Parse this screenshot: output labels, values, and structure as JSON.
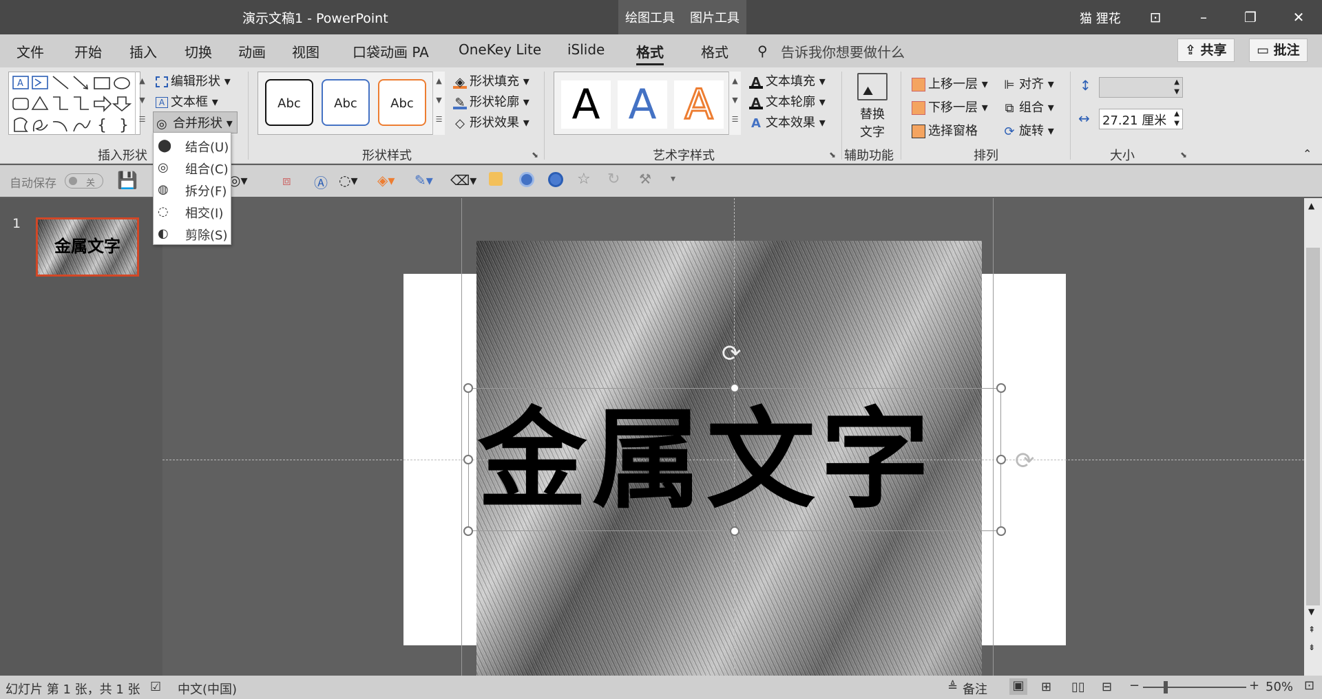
{
  "titlebar": {
    "doc_title": "演示文稿1  -  PowerPoint",
    "context_tabs": [
      "绘图工具",
      "图片工具"
    ],
    "user": "猫 狸花"
  },
  "tabs": {
    "items": [
      "文件",
      "开始",
      "插入",
      "切换",
      "动画",
      "视图",
      "口袋动画 PA",
      "OneKey Lite",
      "iSlide",
      "格式",
      "格式"
    ],
    "active": "格式",
    "search": "告诉我你想要做什么",
    "share": "共享",
    "comment": "批注"
  },
  "ribbon": {
    "insert_shapes": {
      "edit_shape": "编辑形状",
      "textbox": "文本框",
      "merge_shapes": "合并形状",
      "group_label": "插入形状"
    },
    "shape_styles": {
      "preview_text": "Abc",
      "fill": "形状填充",
      "outline": "形状轮廓",
      "effect": "形状效果",
      "group_label": "形状样式"
    },
    "wordart": {
      "letter": "A",
      "text_fill": "文本填充",
      "text_outline": "文本轮廓",
      "text_effect": "文本效果",
      "group_label": "艺术字样式"
    },
    "accessibility": {
      "alt_text_line1": "替换",
      "alt_text_line2": "文字",
      "group_label": "辅助功能"
    },
    "arrange": {
      "bring_forward": "上移一层",
      "send_backward": "下移一层",
      "selection_pane": "选择窗格",
      "align": "对齐",
      "group": "组合",
      "rotate": "旋转",
      "group_label": "排列"
    },
    "size": {
      "height_value": "",
      "width_value": "27.21 厘米",
      "group_label": "大小"
    }
  },
  "qat": {
    "autosave_label": "自动保存",
    "autosave_state": "关"
  },
  "merge_menu": {
    "items": [
      "结合(U)",
      "组合(C)",
      "拆分(F)",
      "相交(I)",
      "剪除(S)"
    ]
  },
  "slides_panel": {
    "slide_number": "1",
    "thumb_text": "金属文字"
  },
  "slide": {
    "text": "金属文字"
  },
  "status": {
    "slide_info": "幻灯片 第 1 张，共 1 张",
    "language": "中文(中国)",
    "notes": "备注",
    "zoom": "50%"
  },
  "colors": {
    "accent_orange": "#d24726",
    "wordart_blue": "#4472c4",
    "wordart_orange": "#ed7d31"
  }
}
